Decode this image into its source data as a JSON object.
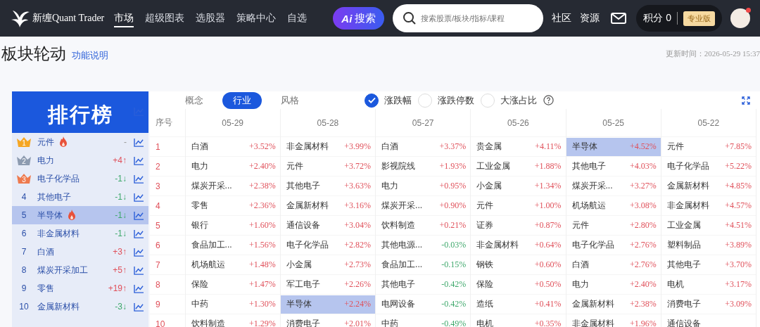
{
  "nav": {
    "brand": "新缠Quant Trader",
    "items": [
      {
        "label": "市场",
        "selected": true
      },
      {
        "label": "超级图表",
        "selected": false
      },
      {
        "label": "选股器",
        "selected": false
      },
      {
        "label": "策略中心",
        "selected": false
      },
      {
        "label": "自选",
        "selected": false
      }
    ],
    "ai_button": {
      "logo": "Ai",
      "label": "搜索"
    },
    "search": {
      "placeholder": "搜索股票/板块/指标/课程"
    },
    "links": [
      "社区",
      "资源"
    ],
    "points": {
      "label": "积分 0",
      "badge": "专业版"
    },
    "avatar": {
      "notification": true
    }
  },
  "page": {
    "title": "板块轮动",
    "help_link": "功能说明",
    "updated": "更新时间：2026-05-29 15:37"
  },
  "ranking": {
    "title": "排行榜",
    "items": [
      {
        "rank": "1",
        "kind": "medal",
        "color": "#f5a623",
        "name": "元件",
        "hot": true,
        "change": "-",
        "selected": false
      },
      {
        "rank": "2",
        "kind": "medal",
        "color": "#8d9bb0",
        "name": "电力",
        "hot": false,
        "change": "+4↑",
        "rising": true,
        "selected": false
      },
      {
        "rank": "3",
        "kind": "medal",
        "color": "#ee7a4e",
        "name": "电子化学品",
        "hot": false,
        "change": "-1↓",
        "rising": false,
        "selected": false
      },
      {
        "rank": "4",
        "kind": "plain",
        "name": "其他电子",
        "hot": false,
        "change": "-1↓",
        "rising": false,
        "selected": false
      },
      {
        "rank": "5",
        "kind": "plain",
        "name": "半导体",
        "hot": true,
        "change": "-1↓",
        "rising": false,
        "selected": true
      },
      {
        "rank": "6",
        "kind": "plain",
        "name": "非金属材料",
        "hot": false,
        "change": "-1↓",
        "rising": false,
        "selected": false
      },
      {
        "rank": "7",
        "kind": "plain",
        "name": "白酒",
        "hot": false,
        "change": "+3↑",
        "rising": true,
        "selected": false
      },
      {
        "rank": "8",
        "kind": "plain",
        "name": "煤炭开采加工",
        "hot": false,
        "change": "+5↑",
        "rising": true,
        "selected": false
      },
      {
        "rank": "9",
        "kind": "plain",
        "name": "零售",
        "hot": false,
        "change": "+19↑",
        "rising": true,
        "selected": false
      },
      {
        "rank": "10",
        "kind": "plain",
        "name": "金属新材料",
        "hot": false,
        "change": "-3↓",
        "rising": false,
        "selected": false
      }
    ]
  },
  "tabs": [
    {
      "label": "概念",
      "selected": false
    },
    {
      "label": "行业",
      "selected": true
    },
    {
      "label": "风格",
      "selected": false
    }
  ],
  "metrics": [
    {
      "label": "涨跌幅",
      "selected": true
    },
    {
      "label": "涨跌停数",
      "selected": false
    },
    {
      "label": "大涨占比",
      "selected": false
    }
  ],
  "table": {
    "index_header": "序号",
    "dates": [
      "05-29",
      "05-28",
      "05-27",
      "05-26",
      "05-25",
      "05-22"
    ],
    "rows": [
      {
        "index": "1",
        "cells": [
          {
            "name": "白酒",
            "pct": "+3.52%",
            "rising": true,
            "selected": false
          },
          {
            "name": "非金属材料",
            "pct": "+3.99%",
            "rising": true,
            "selected": false
          },
          {
            "name": "白酒",
            "pct": "+3.37%",
            "rising": true,
            "selected": false
          },
          {
            "name": "贵金属",
            "pct": "+4.11%",
            "rising": true,
            "selected": false
          },
          {
            "name": "半导体",
            "pct": "+4.52%",
            "rising": true,
            "selected": true
          },
          {
            "name": "元件",
            "pct": "+7.85%",
            "rising": true,
            "selected": false
          }
        ]
      },
      {
        "index": "2",
        "cells": [
          {
            "name": "电力",
            "pct": "+2.40%",
            "rising": true,
            "selected": false
          },
          {
            "name": "元件",
            "pct": "+3.72%",
            "rising": true,
            "selected": false
          },
          {
            "name": "影视院线",
            "pct": "+1.93%",
            "rising": true,
            "selected": false
          },
          {
            "name": "工业金属",
            "pct": "+1.88%",
            "rising": true,
            "selected": false
          },
          {
            "name": "其他电子",
            "pct": "+4.03%",
            "rising": true,
            "selected": false
          },
          {
            "name": "电子化学品",
            "pct": "+5.22%",
            "rising": true,
            "selected": false
          }
        ]
      },
      {
        "index": "3",
        "cells": [
          {
            "name": "煤炭开采...",
            "pct": "+2.38%",
            "rising": true,
            "selected": false
          },
          {
            "name": "其他电子",
            "pct": "+3.63%",
            "rising": true,
            "selected": false
          },
          {
            "name": "电力",
            "pct": "+0.95%",
            "rising": true,
            "selected": false
          },
          {
            "name": "小金属",
            "pct": "+1.34%",
            "rising": true,
            "selected": false
          },
          {
            "name": "煤炭开采...",
            "pct": "+3.27%",
            "rising": true,
            "selected": false
          },
          {
            "name": "金属新材料",
            "pct": "+4.85%",
            "rising": true,
            "selected": false
          }
        ]
      },
      {
        "index": "4",
        "cells": [
          {
            "name": "零售",
            "pct": "+2.36%",
            "rising": true,
            "selected": false
          },
          {
            "name": "金属新材料",
            "pct": "+3.16%",
            "rising": true,
            "selected": false
          },
          {
            "name": "煤炭开采...",
            "pct": "+0.90%",
            "rising": true,
            "selected": false
          },
          {
            "name": "元件",
            "pct": "+1.00%",
            "rising": true,
            "selected": false
          },
          {
            "name": "机场航运",
            "pct": "+3.08%",
            "rising": true,
            "selected": false
          },
          {
            "name": "非金属材料",
            "pct": "+4.57%",
            "rising": true,
            "selected": false
          }
        ]
      },
      {
        "index": "5",
        "cells": [
          {
            "name": "银行",
            "pct": "+1.60%",
            "rising": true,
            "selected": false
          },
          {
            "name": "通信设备",
            "pct": "+3.04%",
            "rising": true,
            "selected": false
          },
          {
            "name": "饮料制造",
            "pct": "+0.21%",
            "rising": true,
            "selected": false
          },
          {
            "name": "证券",
            "pct": "+0.87%",
            "rising": true,
            "selected": false
          },
          {
            "name": "元件",
            "pct": "+2.80%",
            "rising": true,
            "selected": false
          },
          {
            "name": "工业金属",
            "pct": "+4.51%",
            "rising": true,
            "selected": false
          }
        ]
      },
      {
        "index": "6",
        "cells": [
          {
            "name": "食品加工...",
            "pct": "+1.56%",
            "rising": true,
            "selected": false
          },
          {
            "name": "电子化学品",
            "pct": "+2.82%",
            "rising": true,
            "selected": false
          },
          {
            "name": "其他电源...",
            "pct": "-0.03%",
            "rising": false,
            "selected": false
          },
          {
            "name": "非金属材料",
            "pct": "+0.64%",
            "rising": true,
            "selected": false
          },
          {
            "name": "电子化学品",
            "pct": "+2.76%",
            "rising": true,
            "selected": false
          },
          {
            "name": "塑料制品",
            "pct": "+3.89%",
            "rising": true,
            "selected": false
          }
        ]
      },
      {
        "index": "7",
        "cells": [
          {
            "name": "机场航运",
            "pct": "+1.48%",
            "rising": true,
            "selected": false
          },
          {
            "name": "小金属",
            "pct": "+2.73%",
            "rising": true,
            "selected": false
          },
          {
            "name": "食品加工...",
            "pct": "-0.15%",
            "rising": false,
            "selected": false
          },
          {
            "name": "钢铁",
            "pct": "+0.60%",
            "rising": true,
            "selected": false
          },
          {
            "name": "白酒",
            "pct": "+2.76%",
            "rising": true,
            "selected": false
          },
          {
            "name": "其他电子",
            "pct": "+3.70%",
            "rising": true,
            "selected": false
          }
        ]
      },
      {
        "index": "8",
        "cells": [
          {
            "name": "保险",
            "pct": "+1.47%",
            "rising": true,
            "selected": false
          },
          {
            "name": "军工电子",
            "pct": "+2.26%",
            "rising": true,
            "selected": false
          },
          {
            "name": "其他电子",
            "pct": "-0.42%",
            "rising": false,
            "selected": false
          },
          {
            "name": "保险",
            "pct": "+0.50%",
            "rising": true,
            "selected": false
          },
          {
            "name": "电力",
            "pct": "+2.40%",
            "rising": true,
            "selected": false
          },
          {
            "name": "电机",
            "pct": "+3.17%",
            "rising": true,
            "selected": false
          }
        ]
      },
      {
        "index": "9",
        "cells": [
          {
            "name": "中药",
            "pct": "+1.30%",
            "rising": true,
            "selected": false
          },
          {
            "name": "半导体",
            "pct": "+2.24%",
            "rising": true,
            "selected": true
          },
          {
            "name": "电网设备",
            "pct": "-0.42%",
            "rising": false,
            "selected": false
          },
          {
            "name": "造纸",
            "pct": "+0.41%",
            "rising": true,
            "selected": false
          },
          {
            "name": "金属新材料",
            "pct": "+2.38%",
            "rising": true,
            "selected": false
          },
          {
            "name": "消费电子",
            "pct": "+3.09%",
            "rising": true,
            "selected": false
          }
        ]
      },
      {
        "index": "10",
        "cells": [
          {
            "name": "饮料制造",
            "pct": "+1.29%",
            "rising": true,
            "selected": false
          },
          {
            "name": "消费电子",
            "pct": "+2.01%",
            "rising": true,
            "selected": false
          },
          {
            "name": "中药",
            "pct": "-0.49%",
            "rising": false,
            "selected": false
          },
          {
            "name": "电机",
            "pct": "+0.35%",
            "rising": true,
            "selected": false
          },
          {
            "name": "非金属材料",
            "pct": "+1.96%",
            "rising": true,
            "selected": false
          },
          {
            "name": "通信设备",
            "selected": false
          }
        ]
      }
    ]
  }
}
